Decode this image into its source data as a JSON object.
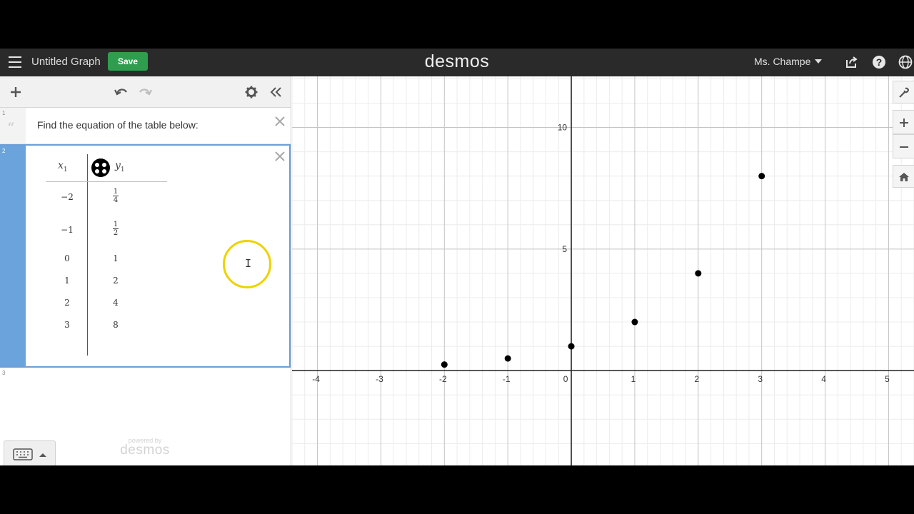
{
  "header": {
    "graph_title": "Untitled Graph",
    "save_label": "Save",
    "brand": "desmos",
    "user_name": "Ms. Champe"
  },
  "expressions": {
    "row1": {
      "number": "1",
      "note": "Find the equation of the table below:"
    },
    "row2": {
      "number": "2",
      "columns": [
        {
          "label": "x",
          "subscript": "1"
        },
        {
          "label": "y",
          "subscript": "1"
        }
      ],
      "rows": [
        {
          "x": "−2",
          "y_num": "1",
          "y_den": "4"
        },
        {
          "x": "−1",
          "y_num": "1",
          "y_den": "2"
        },
        {
          "x": "0",
          "y": "1"
        },
        {
          "x": "1",
          "y": "2"
        },
        {
          "x": "2",
          "y": "4"
        },
        {
          "x": "3",
          "y": "8"
        }
      ]
    },
    "row3": {
      "number": "3"
    }
  },
  "footer": {
    "powered_by": "powered by",
    "brand": "desmos"
  },
  "colors": {
    "header_bg": "#2a2a2a",
    "save_green": "#2f9d4e",
    "active_blue": "#6ba3dd",
    "cursor_highlight": "#ecd300",
    "point": "#000000"
  },
  "chart_data": {
    "type": "scatter",
    "x_ticks": [
      -4,
      -3,
      -2,
      -1,
      0,
      1,
      2,
      3,
      4,
      5
    ],
    "y_ticks": [
      5,
      10
    ],
    "xlim": [
      -4.4,
      5.4
    ],
    "ylim": [
      -3.9,
      12.1
    ],
    "grid": true,
    "points": [
      {
        "x": -2,
        "y": 0.25
      },
      {
        "x": -1,
        "y": 0.5
      },
      {
        "x": 0,
        "y": 1
      },
      {
        "x": 1,
        "y": 2
      },
      {
        "x": 2,
        "y": 4
      },
      {
        "x": 3,
        "y": 8
      }
    ]
  }
}
